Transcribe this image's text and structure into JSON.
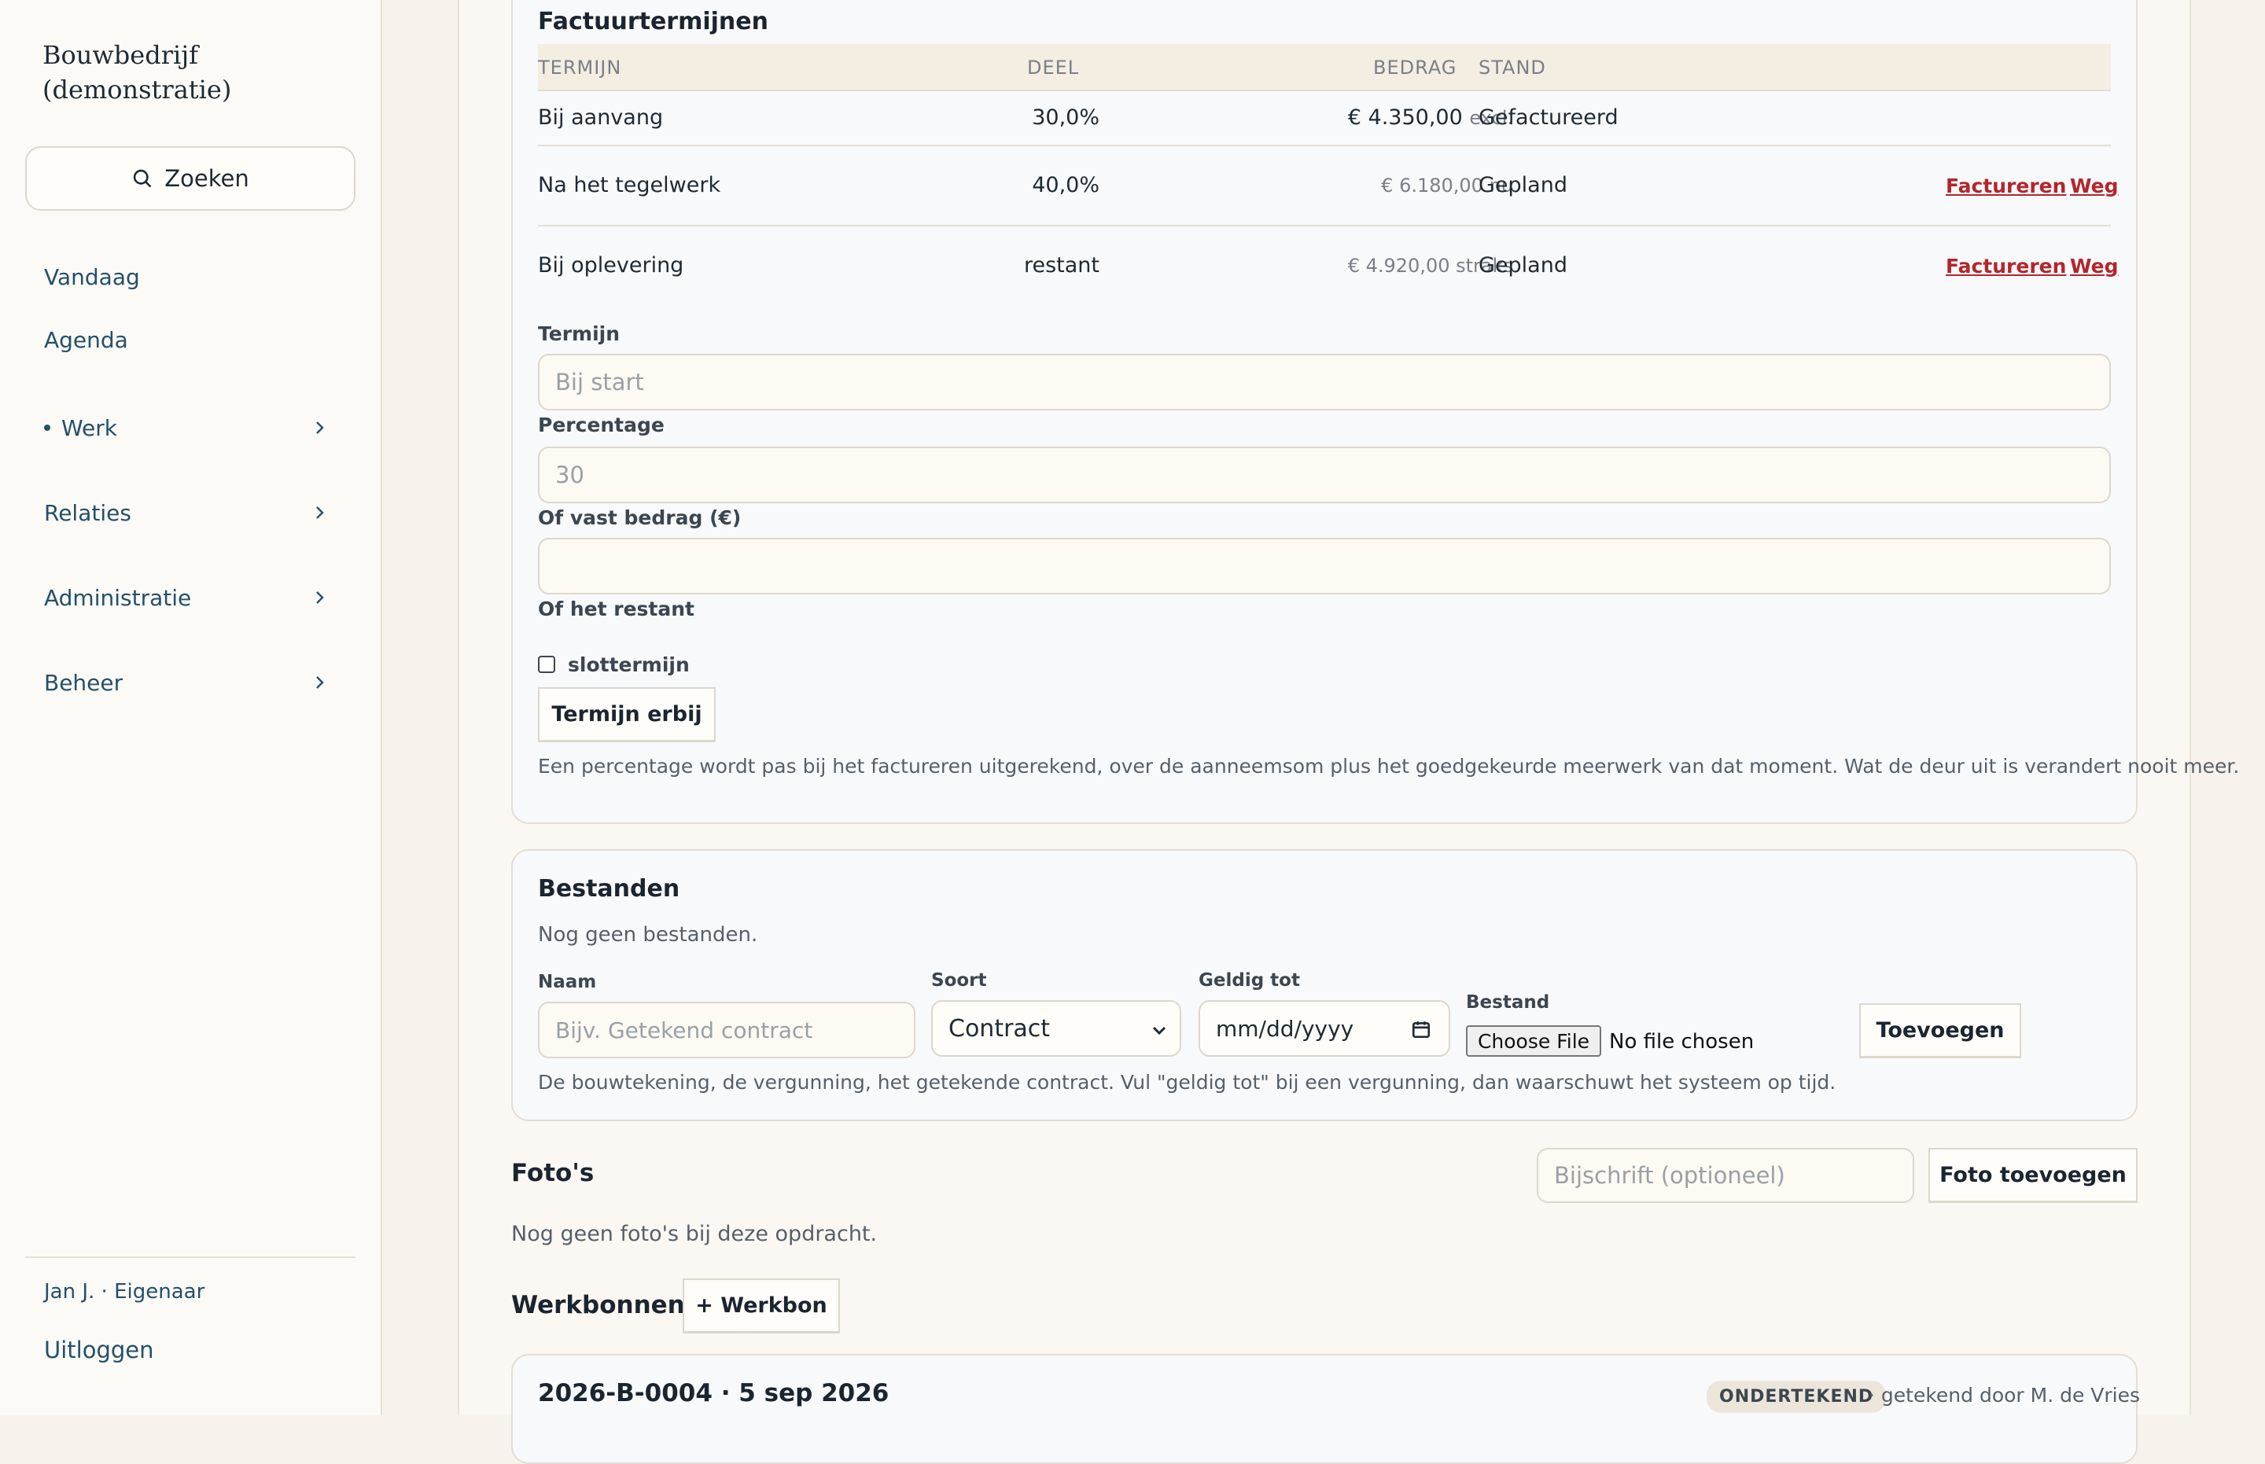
{
  "sidebar": {
    "brand": "Bouwbedrijf (demonstratie)",
    "search_label": "Zoeken",
    "nav": [
      {
        "label": "Vandaag"
      },
      {
        "label": "Agenda"
      },
      {
        "label": "Werk"
      },
      {
        "label": "Relaties"
      },
      {
        "label": "Administratie"
      },
      {
        "label": "Beheer"
      }
    ],
    "user": "Jan J. · Eigenaar",
    "logout": "Uitloggen"
  },
  "terms": {
    "title": "Factuurtermijnen",
    "headers": {
      "termijn": "TERMIJN",
      "deel": "DEEL",
      "bedrag": "BEDRAG",
      "stand": "STAND"
    },
    "rows": [
      {
        "termijn": "Bij aanvang",
        "deel": "30,0%",
        "bedrag": "€ 4.350,00",
        "suffix": "excl.",
        "stand": "Gefactureerd"
      },
      {
        "termijn": "Na het tegelwerk",
        "deel": "40,0%",
        "bedrag": "€ 6.180,00 nu",
        "stand": "Gepland",
        "action": "Factureren",
        "remove": "Weg"
      },
      {
        "termijn": "Bij oplevering",
        "deel": "restant",
        "bedrag": "€ 4.920,00 straks",
        "stand": "Gepland",
        "action": "Factureren",
        "remove": "Weg"
      }
    ],
    "form": {
      "termijn_label": "Termijn",
      "termijn_placeholder": "Bij start",
      "percentage_label": "Percentage",
      "percentage_placeholder": "30",
      "vast_label": "Of vast bedrag (€)",
      "restant_label": "Of het restant",
      "checkbox_label": "slottermijn",
      "submit": "Termijn erbij"
    },
    "help": "Een percentage wordt pas bij het factureren uitgerekend, over de aanneemsom plus het goedgekeurde meerwerk van dat moment. Wat de deur uit is verandert nooit meer."
  },
  "files": {
    "title": "Bestanden",
    "empty": "Nog geen bestanden.",
    "naam_label": "Naam",
    "naam_placeholder": "Bijv. Getekend contract",
    "soort_label": "Soort",
    "soort_value": "Contract",
    "geldig_label": "Geldig tot",
    "geldig_value": "mm/dd/yyyy",
    "bestand_label": "Bestand",
    "choose_file": "Choose File",
    "no_file": "No file chosen",
    "add": "Toevoegen",
    "help": "De bouwtekening, de vergunning, het getekende contract. Vul \"geldig tot\" bij een vergunning, dan waarschuwt het systeem op tijd."
  },
  "photos": {
    "title": "Foto's",
    "caption_placeholder": "Bijschrift (optioneel)",
    "add": "Foto toevoegen",
    "empty": "Nog geen foto's bij deze opdracht."
  },
  "workorders": {
    "title": "Werkbonnen",
    "add": "+ Werkbon",
    "first": {
      "id": "2026-B-0004 · 5 sep 2026",
      "badge": "ONDERTEKEND",
      "signed": "· getekend door M. de Vries"
    }
  }
}
